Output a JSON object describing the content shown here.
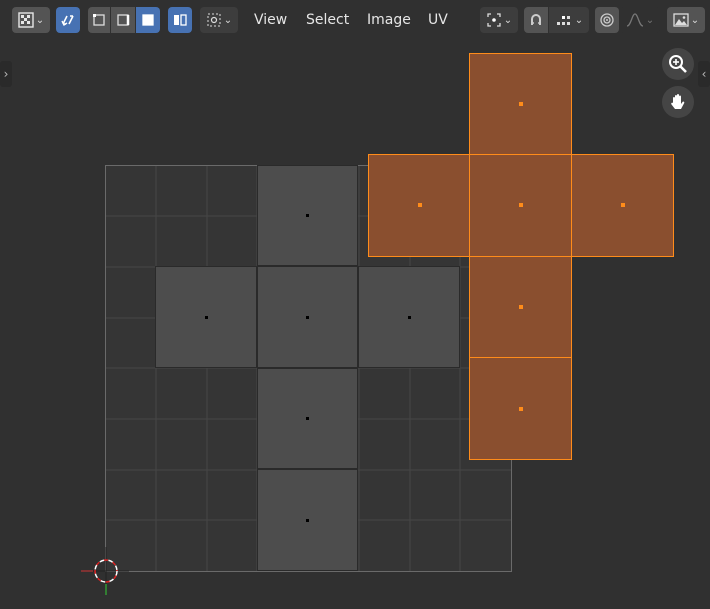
{
  "header": {
    "menus": {
      "view": "View",
      "select": "Select",
      "image": "Image",
      "uv": "UV"
    }
  },
  "icons": {
    "editor_type": "uv-editor-icon",
    "sync_selection": "sync-selection-icon",
    "vertex_mode": "vertex-select-icon",
    "edge_mode": "edge-select-icon",
    "face_mode": "face-select-icon",
    "island_mode": "island-select-icon",
    "sticky_select": "sticky-select-icon",
    "pivot": "pivot-point-icon",
    "snap": "snap-icon",
    "snap_target": "snap-increment-icon",
    "proportional": "proportional-edit-icon",
    "falloff": "falloff-curve-icon",
    "image_browse": "image-browse-icon",
    "zoom": "zoom-icon",
    "pan": "pan-hand-icon",
    "cursor": "2d-cursor-icon"
  },
  "colors": {
    "background": "#303030",
    "selected_face": "#8a4f2f",
    "selected_edge": "#ff8c1a",
    "unselected_face": "#4d4d4d",
    "grid_line": "#5a5a5a",
    "active_button": "#4772b3"
  }
}
